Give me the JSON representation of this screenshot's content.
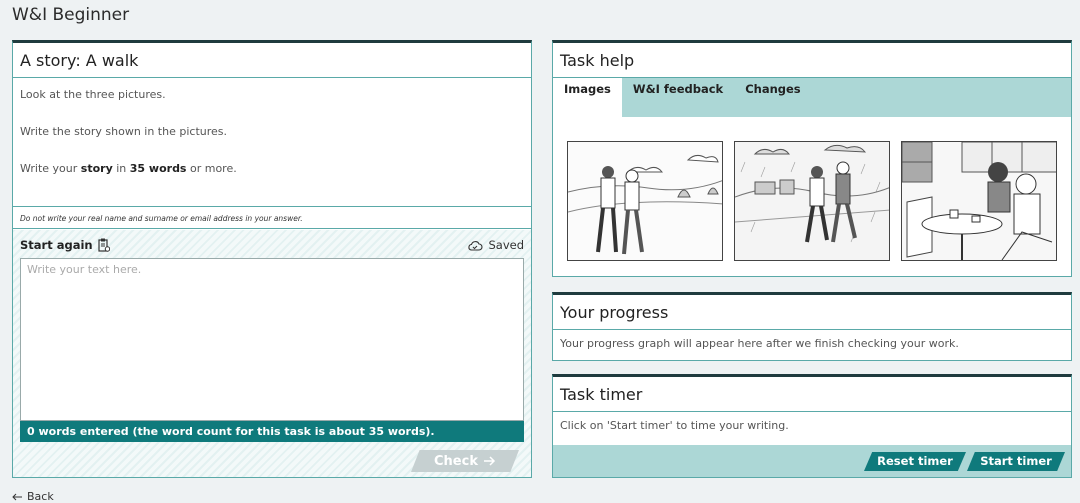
{
  "app": {
    "title": "W&I Beginner"
  },
  "story": {
    "title": "A story: A walk",
    "line1": "Look at the three pictures.",
    "line2": "Write the story shown in the pictures.",
    "line3_pre": "Write your ",
    "line3_bold1": "story",
    "line3_mid": " in ",
    "line3_bold2": "35 words",
    "line3_post": " or more.",
    "privacy": "Do not write your real name and surname or email address in your answer.",
    "start_again": "Start again",
    "saved": "Saved",
    "placeholder": "Write your text here.",
    "word_count": "0 words entered (the word count for this task is about 35 words).",
    "check": "Check"
  },
  "task_help": {
    "title": "Task help",
    "tabs": [
      "Images",
      "W&I feedback",
      "Changes"
    ],
    "active_tab": "Images"
  },
  "progress": {
    "title": "Your progress",
    "text": "Your progress graph will appear here after we finish checking your work."
  },
  "timer": {
    "title": "Task timer",
    "text": "Click on 'Start timer' to time your writing.",
    "reset": "Reset timer",
    "start": "Start timer"
  },
  "nav": {
    "back": "Back"
  },
  "colors": {
    "accent": "#0f7a7c",
    "tab_bar": "#acd7d6",
    "border": "#5aa9a8"
  },
  "icons": [
    "clipboard-reset-icon",
    "cloud-check-icon",
    "arrow-right-icon",
    "arrow-left-icon"
  ]
}
